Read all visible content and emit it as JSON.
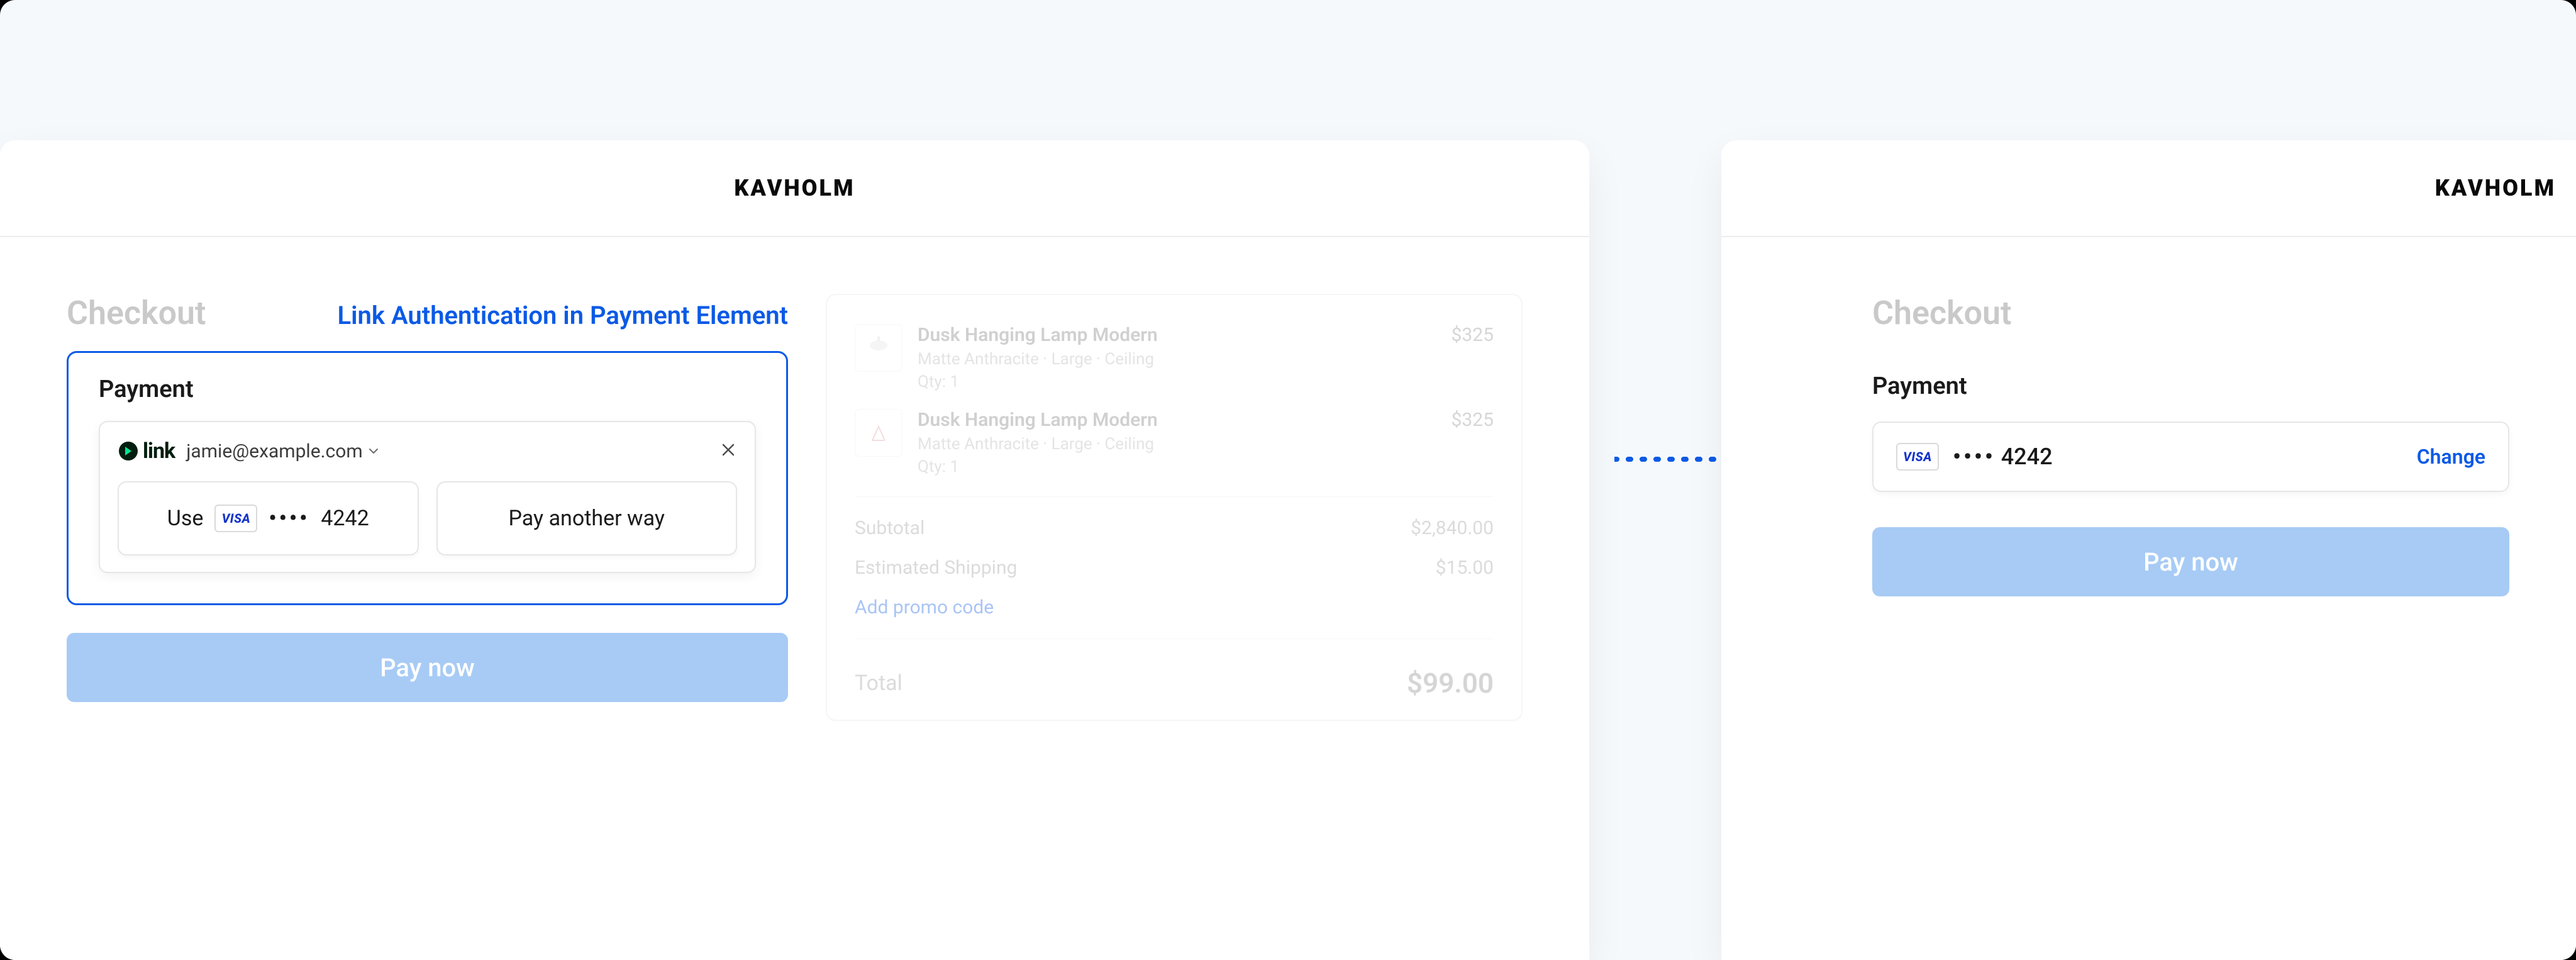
{
  "brand": "KAVHOLM",
  "left": {
    "checkout_label": "Checkout",
    "link_auth_label": "Link Authentication in Payment Element",
    "payment_label": "Payment",
    "link_email": "jamie@example.com",
    "use_label": "Use",
    "card_dots": "••••",
    "card_last4": "4242",
    "pay_another_label": "Pay another way",
    "pay_now_label": "Pay now"
  },
  "order": {
    "items": [
      {
        "title": "Dusk Hanging Lamp Modern",
        "sub": "Matte Anthracite · Large · Ceiling",
        "qty": "Qty: 1",
        "price": "$325"
      },
      {
        "title": "Dusk Hanging Lamp Modern",
        "sub": "Matte Anthracite · Large · Ceiling",
        "qty": "Qty: 1",
        "price": "$325"
      }
    ],
    "subtotal_label": "Subtotal",
    "subtotal": "$2,840.00",
    "shipping_label": "Estimated Shipping",
    "shipping": "$15.00",
    "promo_label": "Add promo code",
    "total_label": "Total",
    "total": "$99.00"
  },
  "right": {
    "checkout_label": "Checkout",
    "payment_label": "Payment",
    "card_dots": "••••",
    "card_last4": "4242",
    "change_label": "Change",
    "pay_now_label": "Pay now"
  }
}
